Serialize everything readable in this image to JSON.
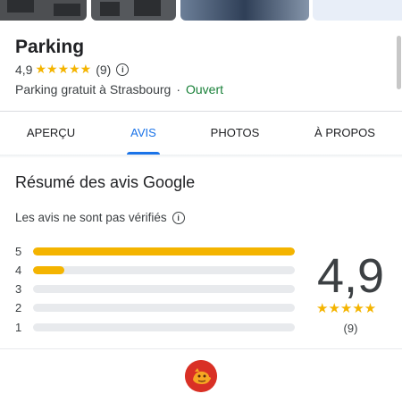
{
  "place": {
    "name": "Parking",
    "rating": "4,9",
    "stars": "★★★★★",
    "review_count": "(9)",
    "info_symbol": "i",
    "category": "Parking gratuit à Strasbourg",
    "separator": "·",
    "status": "Ouvert"
  },
  "tabs": [
    {
      "label": "APERÇU",
      "active": false
    },
    {
      "label": "AVIS",
      "active": true
    },
    {
      "label": "PHOTOS",
      "active": false
    },
    {
      "label": "À PROPOS",
      "active": false
    }
  ],
  "reviews": {
    "title": "Résumé des avis Google",
    "disclaimer": "Les avis ne sont pas vérifiés",
    "info_symbol": "i",
    "distribution": [
      {
        "stars": "5",
        "fraction": 1.0
      },
      {
        "stars": "4",
        "fraction": 0.12
      },
      {
        "stars": "3",
        "fraction": 0
      },
      {
        "stars": "2",
        "fraction": 0
      },
      {
        "stars": "1",
        "fraction": 0
      }
    ],
    "score": "4,9",
    "score_stars": "★★★★★",
    "count": "(9)"
  },
  "colors": {
    "accent": "#1a73e8",
    "star": "#f4b400",
    "open": "#188038",
    "avatar": "#d93025"
  }
}
